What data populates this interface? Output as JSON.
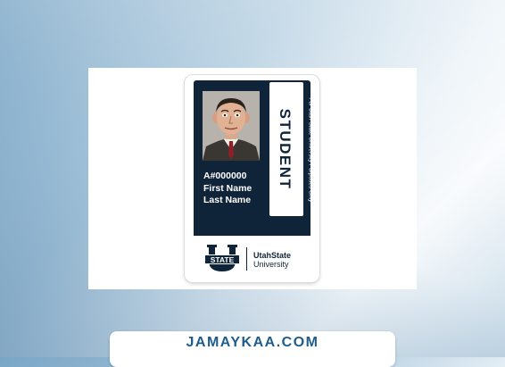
{
  "card": {
    "type_label": "STUDENT",
    "purpose_note": "For Utah State University Purposes Only",
    "id_number": "A#000000",
    "first_name": "First Name",
    "last_name": "Last Name",
    "logo_text": "STATE",
    "university_line1": "UtahState",
    "university_line2": "University"
  },
  "site": {
    "label": "JAMAYKAA.COM"
  },
  "colors": {
    "navy": "#0f2439",
    "site_blue": "#1d5c8f"
  }
}
